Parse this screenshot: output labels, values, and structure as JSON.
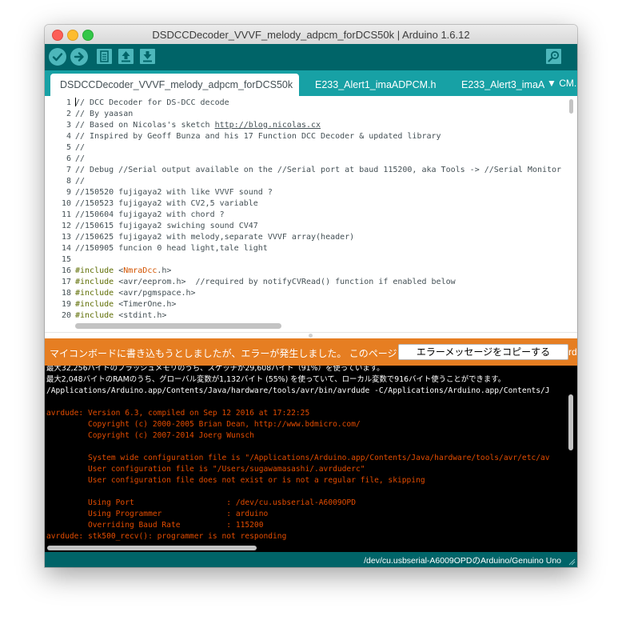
{
  "window": {
    "title": "DSDCCDecoder_VVVF_melody_adpcm_forDCS50k | Arduino 1.6.12"
  },
  "toolbar": {
    "verify_icon": "checkmark-icon",
    "upload_icon": "arrow-right-icon",
    "new_icon": "document-icon",
    "open_icon": "arrow-up-icon",
    "save_icon": "arrow-down-icon",
    "monitor_icon": "magnifier-icon"
  },
  "tabs": [
    {
      "label": "DSDCCDecoder_VVVF_melody_adpcm_forDCS50k"
    },
    {
      "label": "E233_Alert1_imaADPCM.h"
    },
    {
      "label": "E233_Alert3_imaA"
    },
    {
      "label": "CM."
    }
  ],
  "editor": {
    "lines": [
      {
        "n": "1",
        "segs": [
          {
            "t": "// DCC Decoder for DS-DCC decode"
          }
        ]
      },
      {
        "n": "2",
        "segs": [
          {
            "t": "// By yaasan"
          }
        ]
      },
      {
        "n": "3",
        "segs": [
          {
            "t": "// Based on Nicolas's sketch "
          },
          {
            "t": "http://blog.nicolas.cx",
            "c": "url"
          }
        ]
      },
      {
        "n": "4",
        "segs": [
          {
            "t": "// Inspired by Geoff Bunza and his 17 Function DCC Decoder & updated library"
          }
        ]
      },
      {
        "n": "5",
        "segs": [
          {
            "t": "//"
          }
        ]
      },
      {
        "n": "6",
        "segs": [
          {
            "t": "//"
          }
        ]
      },
      {
        "n": "7",
        "segs": [
          {
            "t": "// Debug //Serial output available on the //Serial port at baud 115200, aka Tools -> //Serial Monitor"
          }
        ]
      },
      {
        "n": "8",
        "segs": [
          {
            "t": "//"
          }
        ]
      },
      {
        "n": "9",
        "segs": [
          {
            "t": "//150520 fujigaya2 with like VVVF sound ?"
          }
        ]
      },
      {
        "n": "10",
        "segs": [
          {
            "t": "//150523 fujigaya2 with CV2,5 variable"
          }
        ]
      },
      {
        "n": "11",
        "segs": [
          {
            "t": "//150604 fujigaya2 with chord ?"
          }
        ]
      },
      {
        "n": "12",
        "segs": [
          {
            "t": "//150615 fujigaya2 swiching sound CV47"
          }
        ]
      },
      {
        "n": "13",
        "segs": [
          {
            "t": "//150625 fujigaya2 with melody,separate VVVF array(header)"
          }
        ]
      },
      {
        "n": "14",
        "segs": [
          {
            "t": "//150905 funcion 0 head light,tale light"
          }
        ]
      },
      {
        "n": "15",
        "segs": [
          {
            "t": ""
          }
        ]
      },
      {
        "n": "16",
        "segs": [
          {
            "t": "#include",
            "c": "kw"
          },
          {
            "t": " <"
          },
          {
            "t": "NmraDcc",
            "c": "lib"
          },
          {
            "t": ".h>"
          }
        ]
      },
      {
        "n": "17",
        "segs": [
          {
            "t": "#include",
            "c": "kw"
          },
          {
            "t": " <avr/eeprom.h>  //required by notifyCVRead() function if enabled below"
          }
        ]
      },
      {
        "n": "18",
        "segs": [
          {
            "t": "#include",
            "c": "kw"
          },
          {
            "t": " <avr/pgmspace.h>"
          }
        ]
      },
      {
        "n": "19",
        "segs": [
          {
            "t": "#include",
            "c": "kw"
          },
          {
            "t": " <TimerOne.h>"
          }
        ]
      },
      {
        "n": "20",
        "segs": [
          {
            "t": "#include",
            "c": "kw"
          },
          {
            "t": " <stdint.h>"
          }
        ]
      }
    ]
  },
  "status": {
    "message": "マイコンボードに書き込もうとしましたが、エラーが発生しました。 このページ",
    "copy_button": "エラーメッセージをコピーする",
    "tail": "rd"
  },
  "console": {
    "lines": [
      {
        "t": "最大32,256バイトのフラッシュメモリのうち、スケッチが29,608バイト（91%）を使っています。",
        "c": "w ws"
      },
      {
        "t": "最大2,048バイトのRAMのうち、グローバル変数が1,132バイト (55%) を使っていて、ローカル変数で916バイト使うことができます。",
        "c": "w ws"
      },
      {
        "t": "/Applications/Arduino.app/Contents/Java/hardware/tools/avr/bin/avrdude -C/Applications/Arduino.app/Contents/J",
        "c": "w"
      },
      {
        "t": "",
        "c": "w"
      },
      {
        "t": "avrdude: Version 6.3, compiled on Sep 12 2016 at 17:22:25",
        "c": "o"
      },
      {
        "t": "         Copyright (c) 2000-2005 Brian Dean, http://www.bdmicro.com/",
        "c": "o"
      },
      {
        "t": "         Copyright (c) 2007-2014 Joerg Wunsch",
        "c": "o"
      },
      {
        "t": "",
        "c": "o"
      },
      {
        "t": "         System wide configuration file is \"/Applications/Arduino.app/Contents/Java/hardware/tools/avr/etc/av",
        "c": "o"
      },
      {
        "t": "         User configuration file is \"/Users/sugawamasashi/.avrduderc\"",
        "c": "o"
      },
      {
        "t": "         User configuration file does not exist or is not a regular file, skipping",
        "c": "o"
      },
      {
        "t": "",
        "c": "o"
      },
      {
        "t": "         Using Port                    : /dev/cu.usbserial-A6009OPD",
        "c": "o"
      },
      {
        "t": "         Using Programmer              : arduino",
        "c": "o"
      },
      {
        "t": "         Overriding Baud Rate          : 115200",
        "c": "o"
      },
      {
        "t": "avrdude: stk500_recv(): programmer is not responding",
        "c": "o"
      }
    ]
  },
  "footer": {
    "port_board": "/dev/cu.usbserial-A6009OPDのArduino/Genuino Uno"
  },
  "colors": {
    "toolbar": "#006468",
    "tabs": "#17a1a5",
    "button": "#4db7bb",
    "status": "#e67e22",
    "console_error": "#e34c00"
  }
}
